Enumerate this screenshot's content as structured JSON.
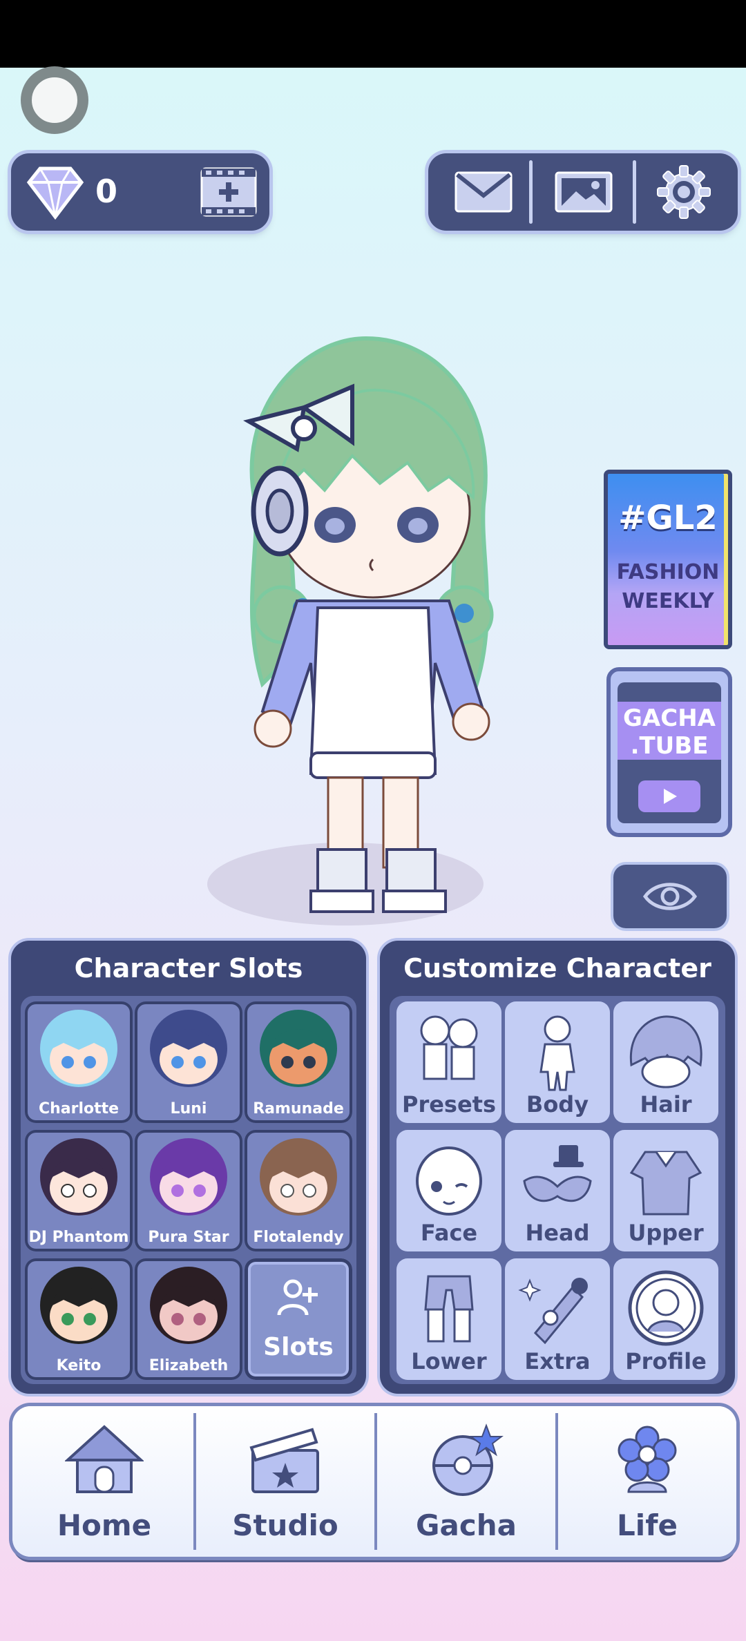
{
  "currency": {
    "gem_count": "0"
  },
  "promos": {
    "gl2": {
      "line1": "#GL2",
      "line2": "FASHION",
      "line3": "WEEKLY"
    },
    "gacha_tube": {
      "line1": "GACHA",
      "line2": ".TUBE"
    }
  },
  "character_slots": {
    "title": "Character Slots",
    "slots": [
      {
        "name": "Charlotte",
        "hair": "#8fd6f2",
        "skin": "#fde3d6",
        "eye": "#4f94e6"
      },
      {
        "name": "Luni",
        "hair": "#3e4b8c",
        "skin": "#fde3d6",
        "eye": "#4f94e6"
      },
      {
        "name": "Ramunade",
        "hair": "#1f6f66",
        "skin": "#ec9a6c",
        "eye": "#2e3a4f"
      },
      {
        "name": "DJ Phantom",
        "hair": "#3a2b4a",
        "skin": "#fde6dc",
        "eye": "#ffffff"
      },
      {
        "name": "Pura Star",
        "hair": "#6a3aa8",
        "skin": "#f8dbe6",
        "eye": "#b070e0"
      },
      {
        "name": "Flotalendy",
        "hair": "#8a6450",
        "skin": "#fbe0d6",
        "eye": "#ffffff"
      },
      {
        "name": "Keito",
        "hair": "#222222",
        "skin": "#fbdcc6",
        "eye": "#3a9a5a"
      },
      {
        "name": "Elizabeth",
        "hair": "#2b1e24",
        "skin": "#f1c9c6",
        "eye": "#b06080"
      }
    ],
    "add_label": "Slots"
  },
  "customize": {
    "title": "Customize Character",
    "buttons": [
      {
        "label": "Presets",
        "icon": "presets-icon"
      },
      {
        "label": "Body",
        "icon": "body-icon"
      },
      {
        "label": "Hair",
        "icon": "hair-icon"
      },
      {
        "label": "Face",
        "icon": "face-icon"
      },
      {
        "label": "Head",
        "icon": "head-icon"
      },
      {
        "label": "Upper",
        "icon": "upper-icon"
      },
      {
        "label": "Lower",
        "icon": "lower-icon"
      },
      {
        "label": "Extra",
        "icon": "extra-icon"
      },
      {
        "label": "Profile",
        "icon": "profile-icon"
      }
    ]
  },
  "nav": {
    "items": [
      {
        "label": "Home",
        "icon": "house-icon"
      },
      {
        "label": "Studio",
        "icon": "clapperboard-icon"
      },
      {
        "label": "Gacha",
        "icon": "gacha-orb-icon"
      },
      {
        "label": "Life",
        "icon": "flower-icon"
      }
    ]
  },
  "colors": {
    "panel": "#3e4877",
    "accent": "#5f6ba3",
    "button": "#c3cdf4",
    "text_dark": "#434d7c"
  }
}
